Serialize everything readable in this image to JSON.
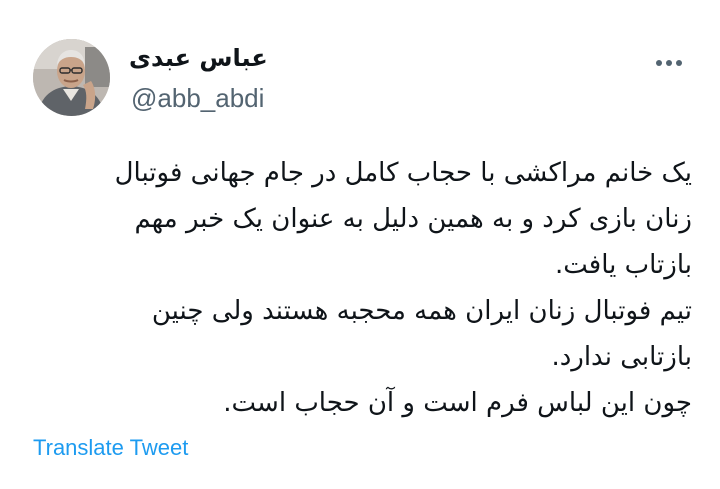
{
  "author": {
    "display_name": "عباس عبدی",
    "handle": "@abb_abdi"
  },
  "tweet": {
    "lines": [
      "یک خانم مراکشی با حجاب کامل در جام جهانی فوتبال",
      "زنان بازی کرد و به همین دلیل به عنوان یک خبر مهم",
      "بازتاب یافت.",
      "تیم فوتبال زنان ایران همه محجبه هستند ولی چنین",
      "بازتابی ندارد.",
      "چون این لباس فرم است و آن حجاب است."
    ]
  },
  "actions": {
    "more_icon": "more-horizontal-icon",
    "translate_label": "Translate Tweet"
  },
  "colors": {
    "text": "#0f1419",
    "secondary": "#536471",
    "link": "#1d9bf0"
  }
}
